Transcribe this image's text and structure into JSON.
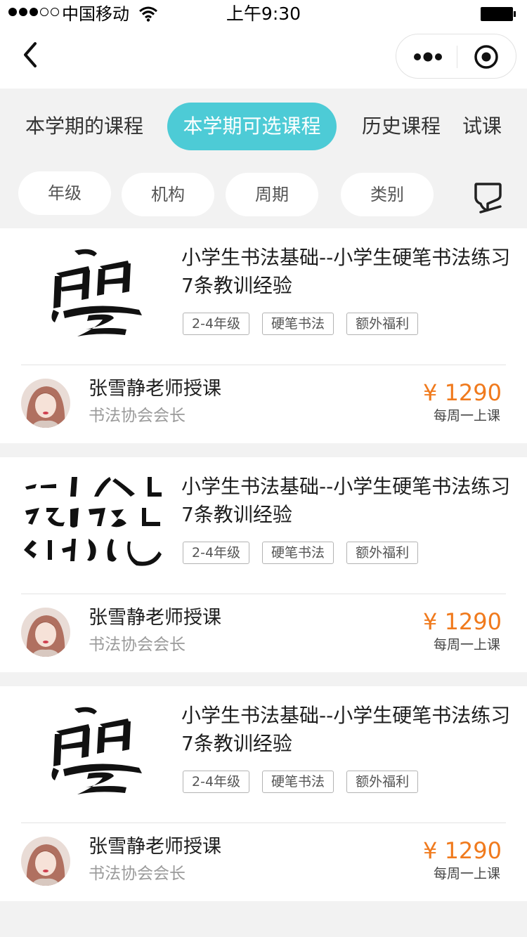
{
  "status_bar": {
    "carrier": "中国移动",
    "time": "上午9:30"
  },
  "nav": {
    "back_icon": "chevron-left-icon",
    "more_icon": "more-dots-icon",
    "close_icon": "target-circle-icon"
  },
  "tabs": [
    {
      "label": "本学期的课程",
      "active": false
    },
    {
      "label": "本学期可选课程",
      "active": true
    },
    {
      "label": "历史课程",
      "active": false
    },
    {
      "label": "试课",
      "active": false
    }
  ],
  "filters": [
    {
      "label": "年级"
    },
    {
      "label": "机构"
    },
    {
      "label": "周期"
    },
    {
      "label": "类别"
    }
  ],
  "filter_icon": "speech-bubble-icon",
  "colors": {
    "accent": "#4dcbd6",
    "price": "#f07a1d",
    "background": "#f2f2f2"
  },
  "courses": [
    {
      "thumbnail": "calligraphy-character-image",
      "title": "小学生书法基础--小学生硬笔书法练习7条教训经验",
      "tags": [
        "2-4年级",
        "硬笔书法",
        "额外福利"
      ],
      "teacher": "张雪静老师授课",
      "role": "书法协会会长",
      "price": "¥ 1290",
      "period": "每周一上课"
    },
    {
      "thumbnail": "calligraphy-strokes-image",
      "title": "小学生书法基础--小学生硬笔书法练习7条教训经验",
      "tags": [
        "2-4年级",
        "硬笔书法",
        "额外福利"
      ],
      "teacher": "张雪静老师授课",
      "role": "书法协会会长",
      "price": "¥ 1290",
      "period": "每周一上课"
    },
    {
      "thumbnail": "calligraphy-character-image",
      "title": "小学生书法基础--小学生硬笔书法练习7条教训经验",
      "tags": [
        "2-4年级",
        "硬笔书法",
        "额外福利"
      ],
      "teacher": "张雪静老师授课",
      "role": "书法协会会长",
      "price": "¥ 1290",
      "period": "每周一上课"
    }
  ]
}
